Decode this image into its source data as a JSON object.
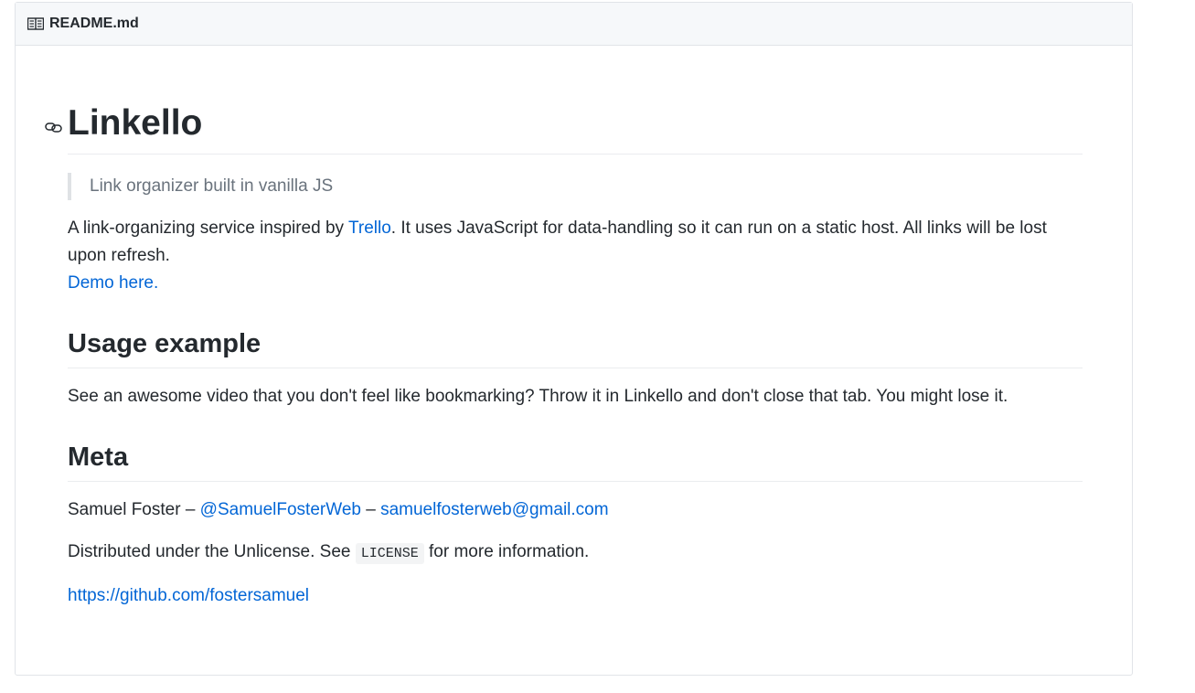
{
  "file": {
    "name": "README.md",
    "icon": "book-icon"
  },
  "readme": {
    "title": "Linkello",
    "tagline": "Link organizer built in vanilla JS",
    "intro_before_link": "A link-organizing service inspired by ",
    "intro_link": "Trello",
    "intro_after_link": ". It uses JavaScript for data-handling so it can run on a static host. All links will be lost upon refresh.",
    "demo_link": "Demo here.",
    "usage_heading": "Usage example",
    "usage_text": "See an awesome video that you don't feel like bookmarking? Throw it in Linkello and don't close that tab. You might lose it.",
    "meta_heading": "Meta",
    "author_name": "Samuel Foster – ",
    "author_handle": "@SamuelFosterWeb",
    "author_sep": " – ",
    "author_email": "samuelfosterweb@gmail.com",
    "license_before": "Distributed under the Unlicense. See ",
    "license_code": "LICENSE",
    "license_after": " for more information.",
    "github_link": "https://github.com/fostersamuel"
  },
  "colors": {
    "link": "#0366d6",
    "text": "#24292e",
    "muted": "#6a737d",
    "header_bg": "#f6f8fa",
    "border": "#e1e4e8"
  }
}
